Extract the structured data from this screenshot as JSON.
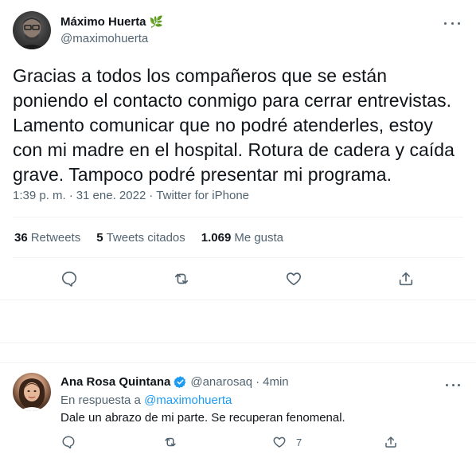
{
  "main_tweet": {
    "author_name": "Máximo Huerta",
    "author_emoji": "🌿",
    "author_handle": "@maximohuerta",
    "text": "Gracias a todos los compañeros que se están poniendo el contacto conmigo para cerrar entrevistas. Lamento comunicar que no podré atenderles, estoy con mi madre en el hospital. Rotura de cadera y caída grave. Tampoco podré presentar mi programa.",
    "time": "1:39 p. m.",
    "sep": "·",
    "date": "31 ene. 2022",
    "source": "Twitter for iPhone",
    "stats": {
      "retweets_count": "36",
      "retweets_label": "Retweets",
      "quotes_count": "5",
      "quotes_label": "Tweets citados",
      "likes_count": "1.069",
      "likes_label": "Me gusta"
    }
  },
  "reply": {
    "author_name": "Ana Rosa Quintana",
    "author_handle": "@anarosaq",
    "sep": "·",
    "time": "4min",
    "reply_prefix": "En respuesta a",
    "reply_mention": "@maximohuerta",
    "text": "Dale un abrazo de mi parte. Se recuperan fenomenal.",
    "like_count": "7"
  },
  "colors": {
    "text": "#0f1419",
    "secondary": "#536471",
    "accent": "#1d9bf0",
    "border": "#eff3f4"
  }
}
